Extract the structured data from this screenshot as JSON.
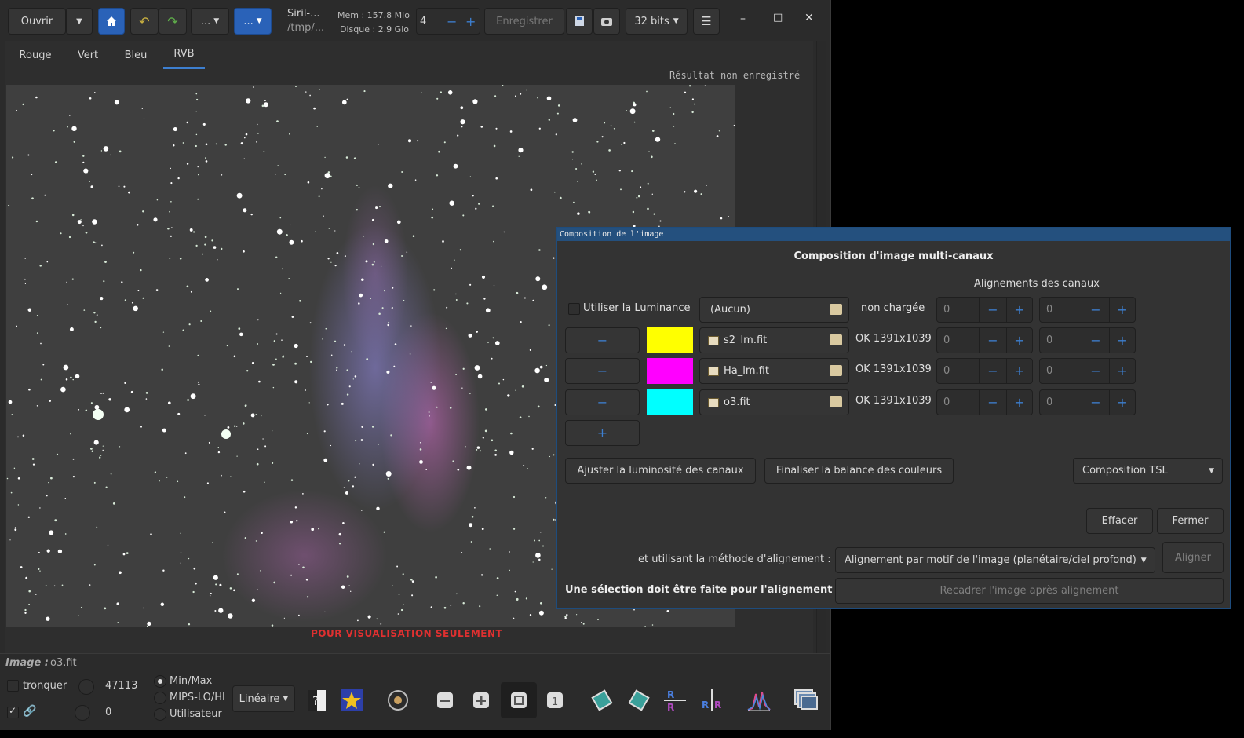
{
  "header": {
    "open_label": "Ouvrir",
    "more_label": "...",
    "more_label_blue": "...",
    "path_title": "Siril-...",
    "path_dir": "/tmp/...",
    "mem": "Mem : 157.8 Mio",
    "disk": "Disque : 2.9 Gio",
    "threads_value": "4",
    "save_label": "Enregistrer",
    "bitdepth_label": "32 bits",
    "minimize": "–",
    "maximize": "□",
    "close": "✕"
  },
  "tabs": [
    {
      "label": "Rouge"
    },
    {
      "label": "Vert"
    },
    {
      "label": "Bleu"
    },
    {
      "label": "RVB"
    }
  ],
  "canvas": {
    "unsaved_notice": "Résultat non enregistré",
    "preview_notice": "POUR VISUALISATION SEULEMENT"
  },
  "bottom": {
    "image_label": "Image :",
    "image_name": "o3.fit",
    "clip_label": "tronquer",
    "high_value": "47113",
    "low_value": "0",
    "scale_minmax": "Min/Max",
    "scale_mips": "MIPS-LO/HI",
    "scale_user": "Utilisateur",
    "stretch_label": "Linéaire"
  },
  "dialog": {
    "window_title": "Composition de l'image",
    "heading": "Composition d'image multi-canaux",
    "alignment_heading": "Alignements des canaux",
    "luminance_label": "Utiliser la Luminance",
    "luminance_file": "(Aucun)",
    "luminance_status": "non chargée",
    "channels": [
      {
        "color": "#ffff00",
        "file": "s2_lm.fit",
        "status": "OK 1391x1039",
        "dx": "0",
        "dy": "0"
      },
      {
        "color": "#ff00ff",
        "file": "Ha_lm.fit",
        "status": "OK 1391x1039",
        "dx": "0",
        "dy": "0"
      },
      {
        "color": "#00ffff",
        "file": "o3.fit",
        "status": "OK 1391x1039",
        "dx": "0",
        "dy": "0"
      }
    ],
    "luminance_dx": "0",
    "luminance_dy": "0",
    "adjust_label": "Ajuster la luminosité des canaux",
    "finalize_label": "Finaliser la balance des couleurs",
    "composition_mode": "Composition TSL",
    "clear_label": "Effacer",
    "close_label": "Fermer",
    "method_label": "et utilisant la méthode d'alignement :",
    "method_value": "Alignement par motif de l'image (planétaire/ciel profond)",
    "align_label": "Aligner",
    "selection_notice": "Une sélection doit être faite pour l'alignement",
    "crop_label": "Recadrer l'image après alignement"
  },
  "colors": {
    "accent": "#2a62b8",
    "warning_text": "#e03030"
  }
}
